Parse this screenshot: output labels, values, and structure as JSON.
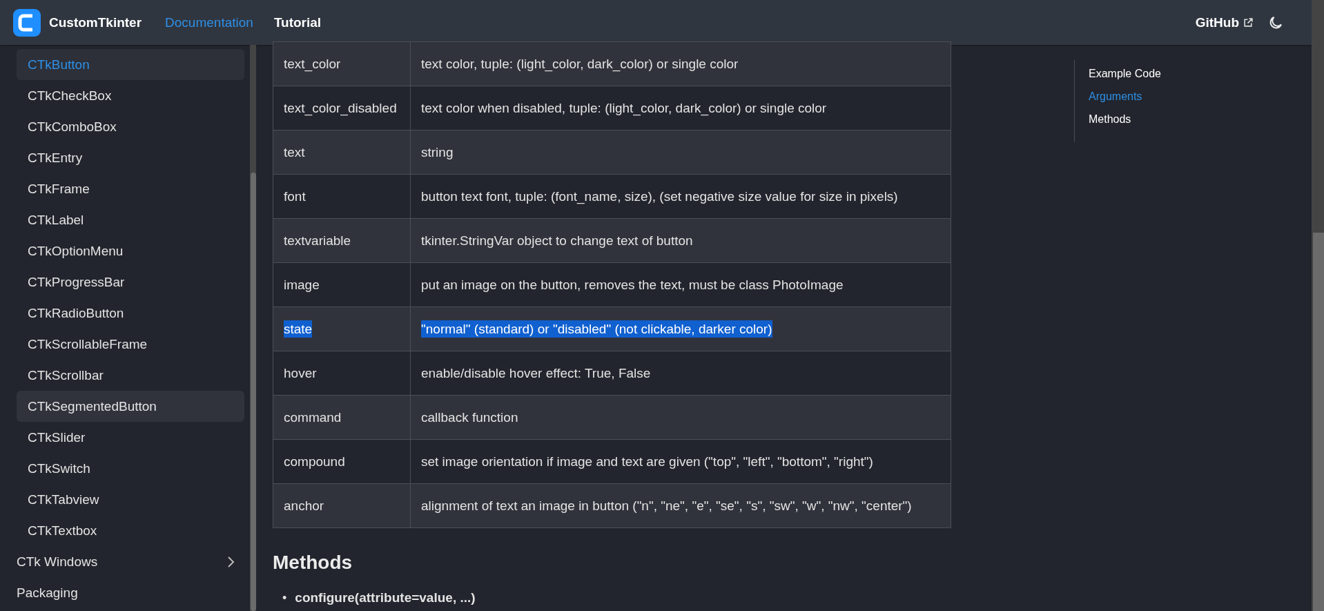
{
  "navbar": {
    "brand": "CustomTkinter",
    "links": [
      {
        "label": "Documentation",
        "selected": true
      },
      {
        "label": "Tutorial",
        "selected": false
      }
    ],
    "github": "GitHub"
  },
  "sidebar": {
    "items": [
      {
        "label": "CTkButton",
        "kind": "sub",
        "selected": true,
        "hovered": false
      },
      {
        "label": "CTkCheckBox",
        "kind": "sub",
        "selected": false,
        "hovered": false
      },
      {
        "label": "CTkComboBox",
        "kind": "sub",
        "selected": false,
        "hovered": false
      },
      {
        "label": "CTkEntry",
        "kind": "sub",
        "selected": false,
        "hovered": false
      },
      {
        "label": "CTkFrame",
        "kind": "sub",
        "selected": false,
        "hovered": false
      },
      {
        "label": "CTkLabel",
        "kind": "sub",
        "selected": false,
        "hovered": false
      },
      {
        "label": "CTkOptionMenu",
        "kind": "sub",
        "selected": false,
        "hovered": false
      },
      {
        "label": "CTkProgressBar",
        "kind": "sub",
        "selected": false,
        "hovered": false
      },
      {
        "label": "CTkRadioButton",
        "kind": "sub",
        "selected": false,
        "hovered": false
      },
      {
        "label": "CTkScrollableFrame",
        "kind": "sub",
        "selected": false,
        "hovered": false
      },
      {
        "label": "CTkScrollbar",
        "kind": "sub",
        "selected": false,
        "hovered": false
      },
      {
        "label": "CTkSegmentedButton",
        "kind": "sub",
        "selected": false,
        "hovered": true
      },
      {
        "label": "CTkSlider",
        "kind": "sub",
        "selected": false,
        "hovered": false
      },
      {
        "label": "CTkSwitch",
        "kind": "sub",
        "selected": false,
        "hovered": false
      },
      {
        "label": "CTkTabview",
        "kind": "sub",
        "selected": false,
        "hovered": false
      },
      {
        "label": "CTkTextbox",
        "kind": "sub",
        "selected": false,
        "hovered": false
      },
      {
        "label": "CTk Windows",
        "kind": "category",
        "selected": false,
        "hovered": false,
        "expanded": false
      },
      {
        "label": "Packaging",
        "kind": "page",
        "selected": false,
        "hovered": false
      }
    ]
  },
  "table": {
    "rows": [
      {
        "cells": [
          "text_color",
          "text color, tuple: (light_color, dark_color) or single color"
        ],
        "highlighted": false
      },
      {
        "cells": [
          "text_color_disabled",
          "text color when disabled, tuple: (light_color, dark_color) or single color"
        ],
        "highlighted": false
      },
      {
        "cells": [
          "text",
          "string"
        ],
        "highlighted": false
      },
      {
        "cells": [
          "font",
          "button text font, tuple: (font_name, size), (set negative size value for size in pixels)"
        ],
        "highlighted": false
      },
      {
        "cells": [
          "textvariable",
          "tkinter.StringVar object to change text of button"
        ],
        "highlighted": false
      },
      {
        "cells": [
          "image",
          "put an image on the button, removes the text, must be class PhotoImage"
        ],
        "highlighted": false
      },
      {
        "cells": [
          "state",
          "\"normal\" (standard) or \"disabled\" (not clickable, darker color)"
        ],
        "highlighted": true
      },
      {
        "cells": [
          "hover",
          "enable/disable hover effect: True, False"
        ],
        "highlighted": false
      },
      {
        "cells": [
          "command",
          "callback function"
        ],
        "highlighted": false
      },
      {
        "cells": [
          "compound",
          "set image orientation if image and text are given (\"top\", \"left\", \"bottom\", \"right\")"
        ],
        "highlighted": false
      },
      {
        "cells": [
          "anchor",
          "alignment of text an image in button (\"n\", \"ne\", \"e\", \"se\", \"s\", \"sw\", \"w\", \"nw\", \"center\")"
        ],
        "highlighted": false
      }
    ]
  },
  "heading": "Methods",
  "methods": [
    {
      "bullet": "•",
      "text": "configure(attribute=value, ...)"
    }
  ],
  "toc": [
    {
      "label": "Example Code",
      "selected": false
    },
    {
      "label": "Arguments",
      "selected": true
    },
    {
      "label": "Methods",
      "selected": false
    }
  ]
}
